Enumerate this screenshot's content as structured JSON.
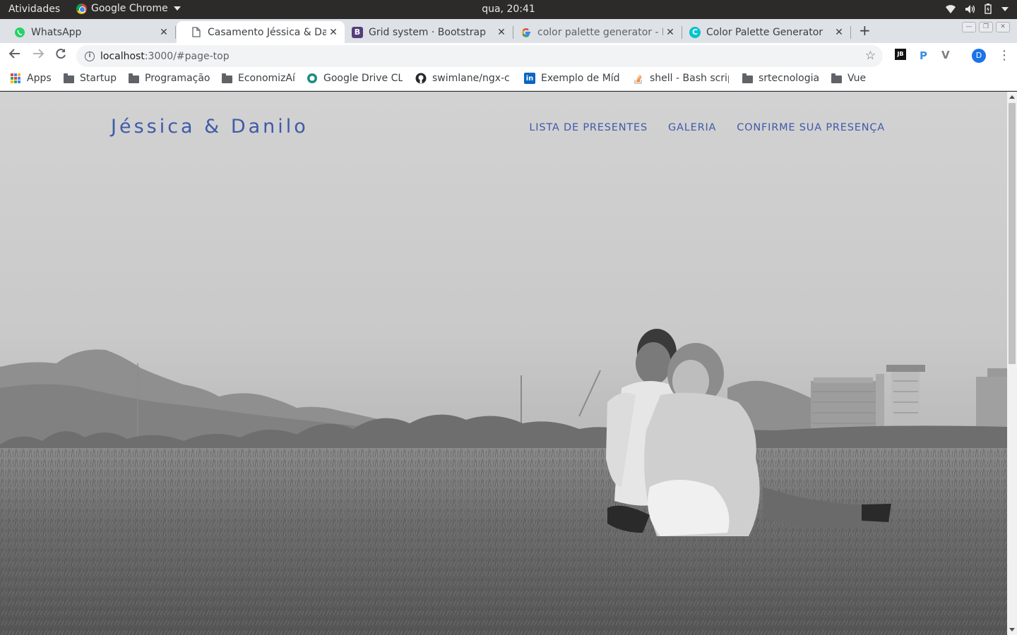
{
  "os_bar": {
    "activities": "Atividades",
    "app_name": "Google Chrome",
    "clock": "qua, 20:41"
  },
  "tabs": [
    {
      "title": "WhatsApp",
      "icon": "whatsapp-icon",
      "active": false
    },
    {
      "title": "Casamento Jéssica & Dan",
      "icon": "document-icon",
      "active": true
    },
    {
      "title": "Grid system · Bootstrap",
      "icon": "bootstrap-icon",
      "active": false
    },
    {
      "title": "color palette generator - F",
      "icon": "google-icon",
      "active": false
    },
    {
      "title": "Color Palette Generator",
      "icon": "canva-icon",
      "active": false
    }
  ],
  "address_bar": {
    "host": "localhost",
    "path": ":3000/#page-top"
  },
  "extensions": {
    "jetbrains": "JB",
    "pocket": "P",
    "vue": "V",
    "profile_initial": "D"
  },
  "bookmarks": [
    {
      "label": "Apps",
      "icon": "apps-grid-icon"
    },
    {
      "label": "Startup",
      "icon": "folder-icon"
    },
    {
      "label": "Programação",
      "icon": "folder-icon"
    },
    {
      "label": "EconomizAí",
      "icon": "folder-icon"
    },
    {
      "label": "Google Drive CLI",
      "icon": "drive-cli-icon"
    },
    {
      "label": "swimlane/ngx-c",
      "icon": "github-icon"
    },
    {
      "label": "Exemplo de Mídi",
      "icon": "linkedin-icon"
    },
    {
      "label": "shell - Bash scrip",
      "icon": "stackoverflow-icon"
    },
    {
      "label": "srtecnologia",
      "icon": "folder-icon"
    },
    {
      "label": "Vue",
      "icon": "folder-icon"
    }
  ],
  "site": {
    "brand": "Jéssica & Danilo",
    "nav": [
      "LISTA DE PRESENTES",
      "GALERIA",
      "CONFIRME SUA PRESENÇA"
    ],
    "accent_color": "#3f5aa8"
  }
}
